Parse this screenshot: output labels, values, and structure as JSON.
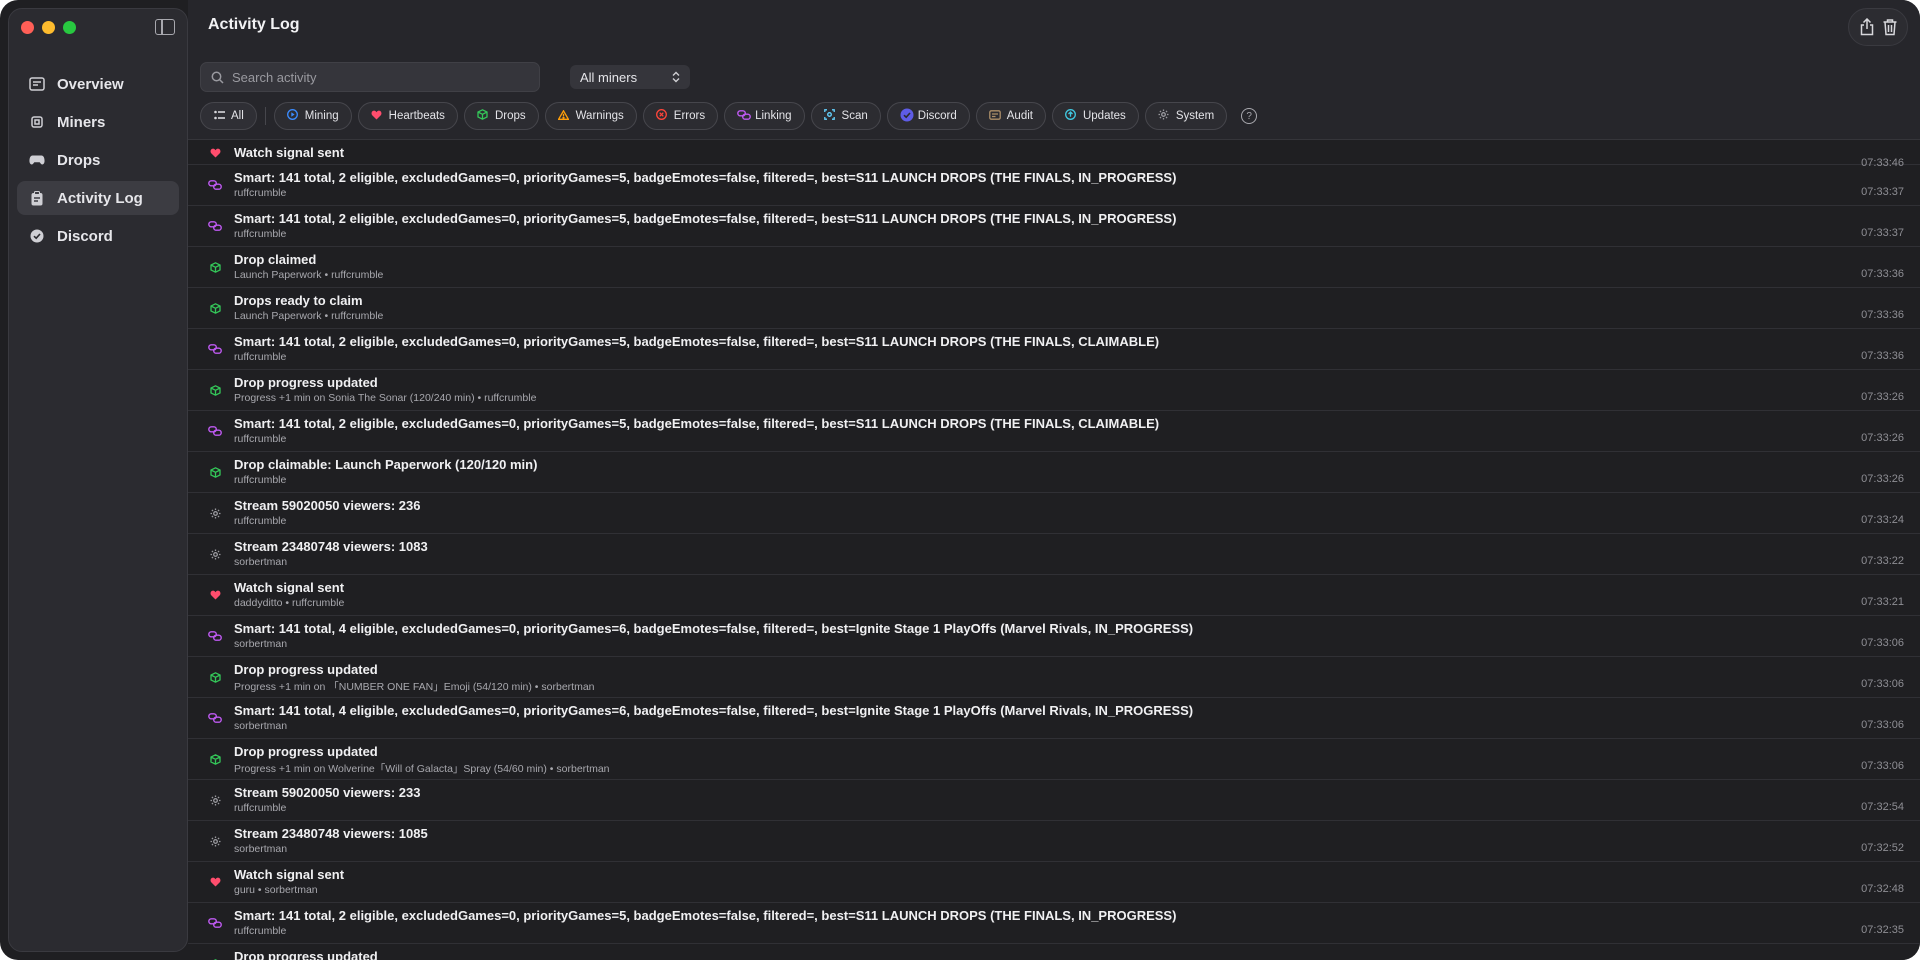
{
  "window": {
    "title": "Activity Log"
  },
  "sidebar": {
    "items": [
      {
        "label": "Overview",
        "icon": "overview-icon",
        "active": false
      },
      {
        "label": "Miners",
        "icon": "chip-icon",
        "active": false
      },
      {
        "label": "Drops",
        "icon": "gamepad-icon",
        "active": false
      },
      {
        "label": "Activity Log",
        "icon": "clipboard-icon",
        "active": true
      },
      {
        "label": "Discord",
        "icon": "discord-icon",
        "active": false
      }
    ]
  },
  "toolbar": {
    "search_placeholder": "Search activity",
    "miner_filter": "All miners"
  },
  "filters": [
    {
      "label": "All",
      "icon": "list-icon",
      "color": "#d8d8dc"
    },
    {
      "label": "Mining",
      "icon": "play-icon",
      "color": "#3b8cff"
    },
    {
      "label": "Heartbeats",
      "icon": "heart-icon",
      "color": "#ff4d6d"
    },
    {
      "label": "Drops",
      "icon": "box-icon",
      "color": "#34c759"
    },
    {
      "label": "Warnings",
      "icon": "warning-icon",
      "color": "#ff9f0a"
    },
    {
      "label": "Errors",
      "icon": "error-icon",
      "color": "#ff453a"
    },
    {
      "label": "Linking",
      "icon": "link-icon",
      "color": "#bf5af2"
    },
    {
      "label": "Scan",
      "icon": "scan-icon",
      "color": "#64d2ff"
    },
    {
      "label": "Discord",
      "icon": "discord-icon",
      "color": "#5e5ce6"
    },
    {
      "label": "Audit",
      "icon": "audit-icon",
      "color": "#ac8e68"
    },
    {
      "label": "Updates",
      "icon": "update-icon",
      "color": "#40c8e0"
    },
    {
      "label": "System",
      "icon": "gear-icon",
      "color": "#98989d"
    }
  ],
  "colors": {
    "heartbeat": "#ff4d6d",
    "linking": "#bf5af2",
    "drops": "#34c759",
    "system": "#98989d"
  },
  "log": [
    {
      "type": "heartbeat",
      "title": "Watch signal sent",
      "sub": "",
      "time": "07:33:46"
    },
    {
      "type": "linking",
      "title": "Smart: 141 total, 2 eligible, excludedGames=0, priorityGames=5, badgeEmotes=false, filtered=, best=S11 LAUNCH DROPS (THE FINALS, IN_PROGRESS)",
      "sub": "ruffcrumble",
      "time": "07:33:37"
    },
    {
      "type": "linking",
      "title": "Smart: 141 total, 2 eligible, excludedGames=0, priorityGames=5, badgeEmotes=false, filtered=, best=S11 LAUNCH DROPS (THE FINALS, IN_PROGRESS)",
      "sub": "ruffcrumble",
      "time": "07:33:37"
    },
    {
      "type": "drops",
      "title": "Drop claimed",
      "sub": "Launch Paperwork • ruffcrumble",
      "time": "07:33:36"
    },
    {
      "type": "drops",
      "title": "Drops ready to claim",
      "sub": "Launch Paperwork • ruffcrumble",
      "time": "07:33:36"
    },
    {
      "type": "linking",
      "title": "Smart: 141 total, 2 eligible, excludedGames=0, priorityGames=5, badgeEmotes=false, filtered=, best=S11 LAUNCH DROPS (THE FINALS, CLAIMABLE)",
      "sub": "ruffcrumble",
      "time": "07:33:36"
    },
    {
      "type": "drops",
      "title": "Drop progress updated",
      "sub": "Progress +1 min on Sonia The Sonar (120/240 min) • ruffcrumble",
      "time": "07:33:26"
    },
    {
      "type": "linking",
      "title": "Smart: 141 total, 2 eligible, excludedGames=0, priorityGames=5, badgeEmotes=false, filtered=, best=S11 LAUNCH DROPS (THE FINALS, CLAIMABLE)",
      "sub": "ruffcrumble",
      "time": "07:33:26"
    },
    {
      "type": "drops",
      "title": "Drop claimable: Launch Paperwork (120/120 min)",
      "sub": "ruffcrumble",
      "time": "07:33:26"
    },
    {
      "type": "system",
      "title": "Stream 59020050 viewers: 236",
      "sub": "ruffcrumble",
      "time": "07:33:24"
    },
    {
      "type": "system",
      "title": "Stream 23480748 viewers: 1083",
      "sub": "sorbertman",
      "time": "07:33:22"
    },
    {
      "type": "heartbeat",
      "title": "Watch signal sent",
      "sub": "daddyditto • ruffcrumble",
      "time": "07:33:21"
    },
    {
      "type": "linking",
      "title": "Smart: 141 total, 4 eligible, excludedGames=0, priorityGames=6, badgeEmotes=false, filtered=, best=Ignite Stage 1 PlayOffs (Marvel Rivals, IN_PROGRESS)",
      "sub": "sorbertman",
      "time": "07:33:06"
    },
    {
      "type": "drops",
      "title": "Drop progress updated",
      "sub": "Progress +1 min on 「NUMBER ONE FAN」Emoji (54/120 min) • sorbertman",
      "time": "07:33:06"
    },
    {
      "type": "linking",
      "title": "Smart: 141 total, 4 eligible, excludedGames=0, priorityGames=6, badgeEmotes=false, filtered=, best=Ignite Stage 1 PlayOffs (Marvel Rivals, IN_PROGRESS)",
      "sub": "sorbertman",
      "time": "07:33:06"
    },
    {
      "type": "drops",
      "title": "Drop progress updated",
      "sub": "Progress +1 min on Wolverine「Will of Galacta」Spray (54/60 min) • sorbertman",
      "time": "07:33:06"
    },
    {
      "type": "system",
      "title": "Stream 59020050 viewers: 233",
      "sub": "ruffcrumble",
      "time": "07:32:54"
    },
    {
      "type": "system",
      "title": "Stream 23480748 viewers: 1085",
      "sub": "sorbertman",
      "time": "07:32:52"
    },
    {
      "type": "heartbeat",
      "title": "Watch signal sent",
      "sub": "guru • sorbertman",
      "time": "07:32:48"
    },
    {
      "type": "linking",
      "title": "Smart: 141 total, 2 eligible, excludedGames=0, priorityGames=5, badgeEmotes=false, filtered=, best=S11 LAUNCH DROPS (THE FINALS, IN_PROGRESS)",
      "sub": "ruffcrumble",
      "time": "07:32:35"
    },
    {
      "type": "drops",
      "title": "Drop progress updated",
      "sub": "",
      "time": ""
    }
  ]
}
